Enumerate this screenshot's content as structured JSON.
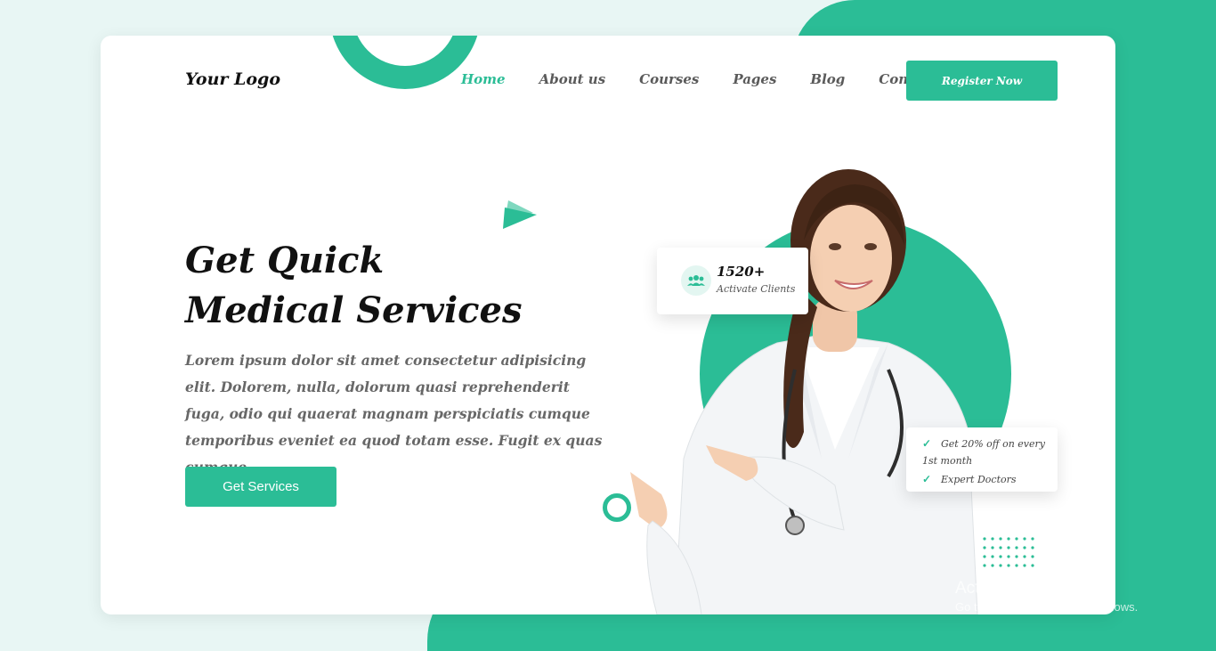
{
  "header": {
    "logo": "Your Logo",
    "nav": [
      "Home",
      "About us",
      "Courses",
      "Pages",
      "Blog",
      "Contact"
    ],
    "active_nav": "Home",
    "register_label": "Register Now"
  },
  "hero": {
    "title_line1": "Get Quick",
    "title_line2": "Medical Services",
    "text": "Lorem ipsum dolor sit amet consectetur adipisicing elit. Dolorem, nulla, dolorum quasi reprehenderit fuga, odio qui quaerat magnam perspiciatis cumque temporibus eveniet ea quod totam esse. Fugit ex quas cumque.",
    "cta_label": "Get Services"
  },
  "stat_card": {
    "icon": "users-icon",
    "number": "1520+",
    "label": "Activate Clients"
  },
  "offer_card": {
    "line1a": "Get 20% off on every",
    "line1b": "1st month",
    "line2": "Expert Doctors"
  },
  "watermark": {
    "line1": "Activate Windows",
    "line2": "Go to Settings to activate Windows."
  },
  "colors": {
    "accent": "#2bbd96",
    "background": "#e8f6f4",
    "heading": "#111111",
    "body_text": "#676767"
  }
}
